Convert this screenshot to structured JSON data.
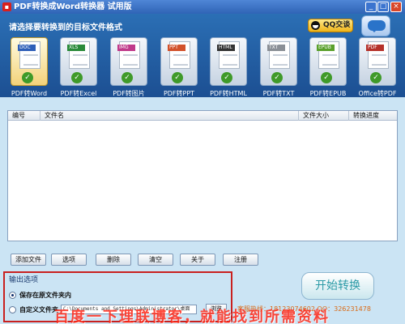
{
  "window": {
    "title": "PDF转换成Word转换器 试用版",
    "controls": {
      "minimize": "_",
      "maximize": "□",
      "close": "×"
    }
  },
  "top_panel": {
    "prompt": "请选择要转换到的目标文件格式",
    "qq_button": "QQ交谈",
    "formats": [
      {
        "badge": "DOC",
        "label": "PDF转Word",
        "color": "#2e5fb8"
      },
      {
        "badge": "XLS",
        "label": "PDF转Excel",
        "color": "#2a8a3a"
      },
      {
        "badge": "IMG",
        "label": "PDF转图片",
        "color": "#c03a8a"
      },
      {
        "badge": "PPT",
        "label": "PDF转PPT",
        "color": "#d2512b"
      },
      {
        "badge": "HTML",
        "label": "PDF转HTML",
        "color": "#333333"
      },
      {
        "badge": "TXT",
        "label": "PDF转TXT",
        "color": "#8a8f96"
      },
      {
        "badge": "EPUB",
        "label": "PDF转EPUB",
        "color": "#5aa02c"
      },
      {
        "badge": "PDF",
        "label": "Office转PDF",
        "color": "#b5312a"
      }
    ]
  },
  "file_table": {
    "columns": [
      "编号",
      "文件名",
      "文件大小",
      "转换进度"
    ],
    "rows": []
  },
  "actions": {
    "add": "添加文件",
    "options": "选项",
    "delete": "删除",
    "clear": "清空",
    "about": "关于",
    "register": "注册"
  },
  "output": {
    "title": "输出选项",
    "opt_same": "保存在原文件夹内",
    "opt_custom": "自定义文件夹",
    "path": "C:\\Documents and Settings\\Administrator\\桌面",
    "browse": "浏览"
  },
  "start_button": "开始转换",
  "contact": "客服热线：18123074602 QQ：326231478",
  "watermark": "百度一下理联博客，就能找到所需资料"
}
